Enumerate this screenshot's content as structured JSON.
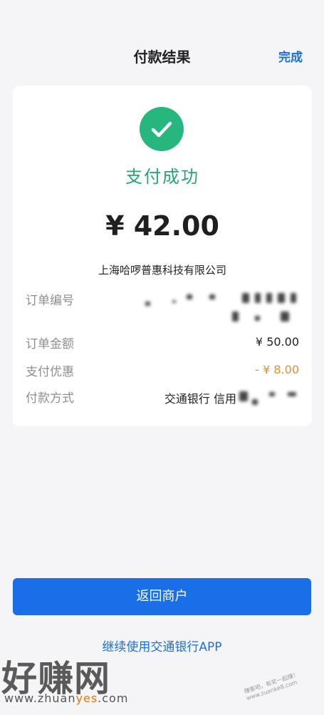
{
  "header": {
    "title": "付款结果",
    "done_label": "完成"
  },
  "result": {
    "status": "支付成功",
    "amount": "¥ 42.00",
    "merchant": "上海哈啰普惠科技有限公司",
    "rows": [
      {
        "label": "订单编号",
        "value": ""
      },
      {
        "label": "订单金额",
        "value": "¥ 50.00"
      },
      {
        "label": "支付优惠",
        "value": "- ¥ 8.00"
      },
      {
        "label": "付款方式",
        "value": "交通银行 信用"
      }
    ]
  },
  "buttons": {
    "return_label": "返回商户"
  },
  "link": {
    "label": "继续使用交通银行APP"
  },
  "watermark": {
    "big": "好赚网",
    "url_pre": "www.zhuan",
    "url_accent": "yes",
    "url_post": ".com",
    "stamp": "赚客吧，有奖一起赚！ www.zuanke8.com"
  },
  "colors": {
    "accent": "#1a6fe8",
    "success": "#26b77f",
    "discount": "#f08a24"
  },
  "icons": {
    "status": "check-icon"
  }
}
